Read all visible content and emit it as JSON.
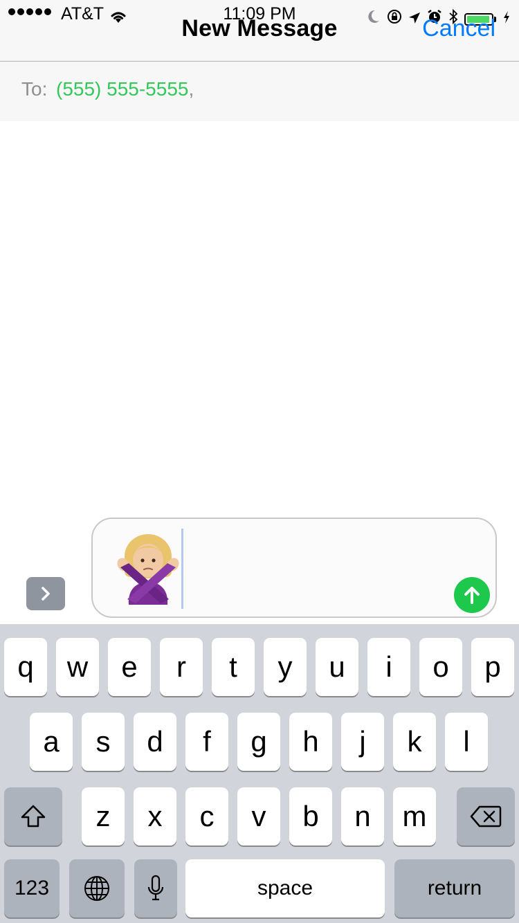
{
  "status_bar": {
    "carrier": "AT&T",
    "time": "11:09 PM",
    "battery_level": 0.95
  },
  "nav": {
    "title": "New Message",
    "cancel_label": "Cancel"
  },
  "to_field": {
    "label": "To:",
    "recipient": "(555) 555-5555",
    "separator": ","
  },
  "compose": {
    "emoji": "🙅🏼‍♀️"
  },
  "keyboard": {
    "row1": [
      "q",
      "w",
      "e",
      "r",
      "t",
      "y",
      "u",
      "i",
      "o",
      "p"
    ],
    "row2": [
      "a",
      "s",
      "d",
      "f",
      "g",
      "h",
      "j",
      "k",
      "l"
    ],
    "row3": [
      "z",
      "x",
      "c",
      "v",
      "b",
      "n",
      "m"
    ],
    "numbers_label": "123",
    "space_label": "space",
    "return_label": "return"
  },
  "colors": {
    "accent": "#007aff",
    "recipient": "#34c759",
    "send": "#1ec84d",
    "keyboard_bg": "#d1d5db",
    "battery": "#4cd964"
  }
}
